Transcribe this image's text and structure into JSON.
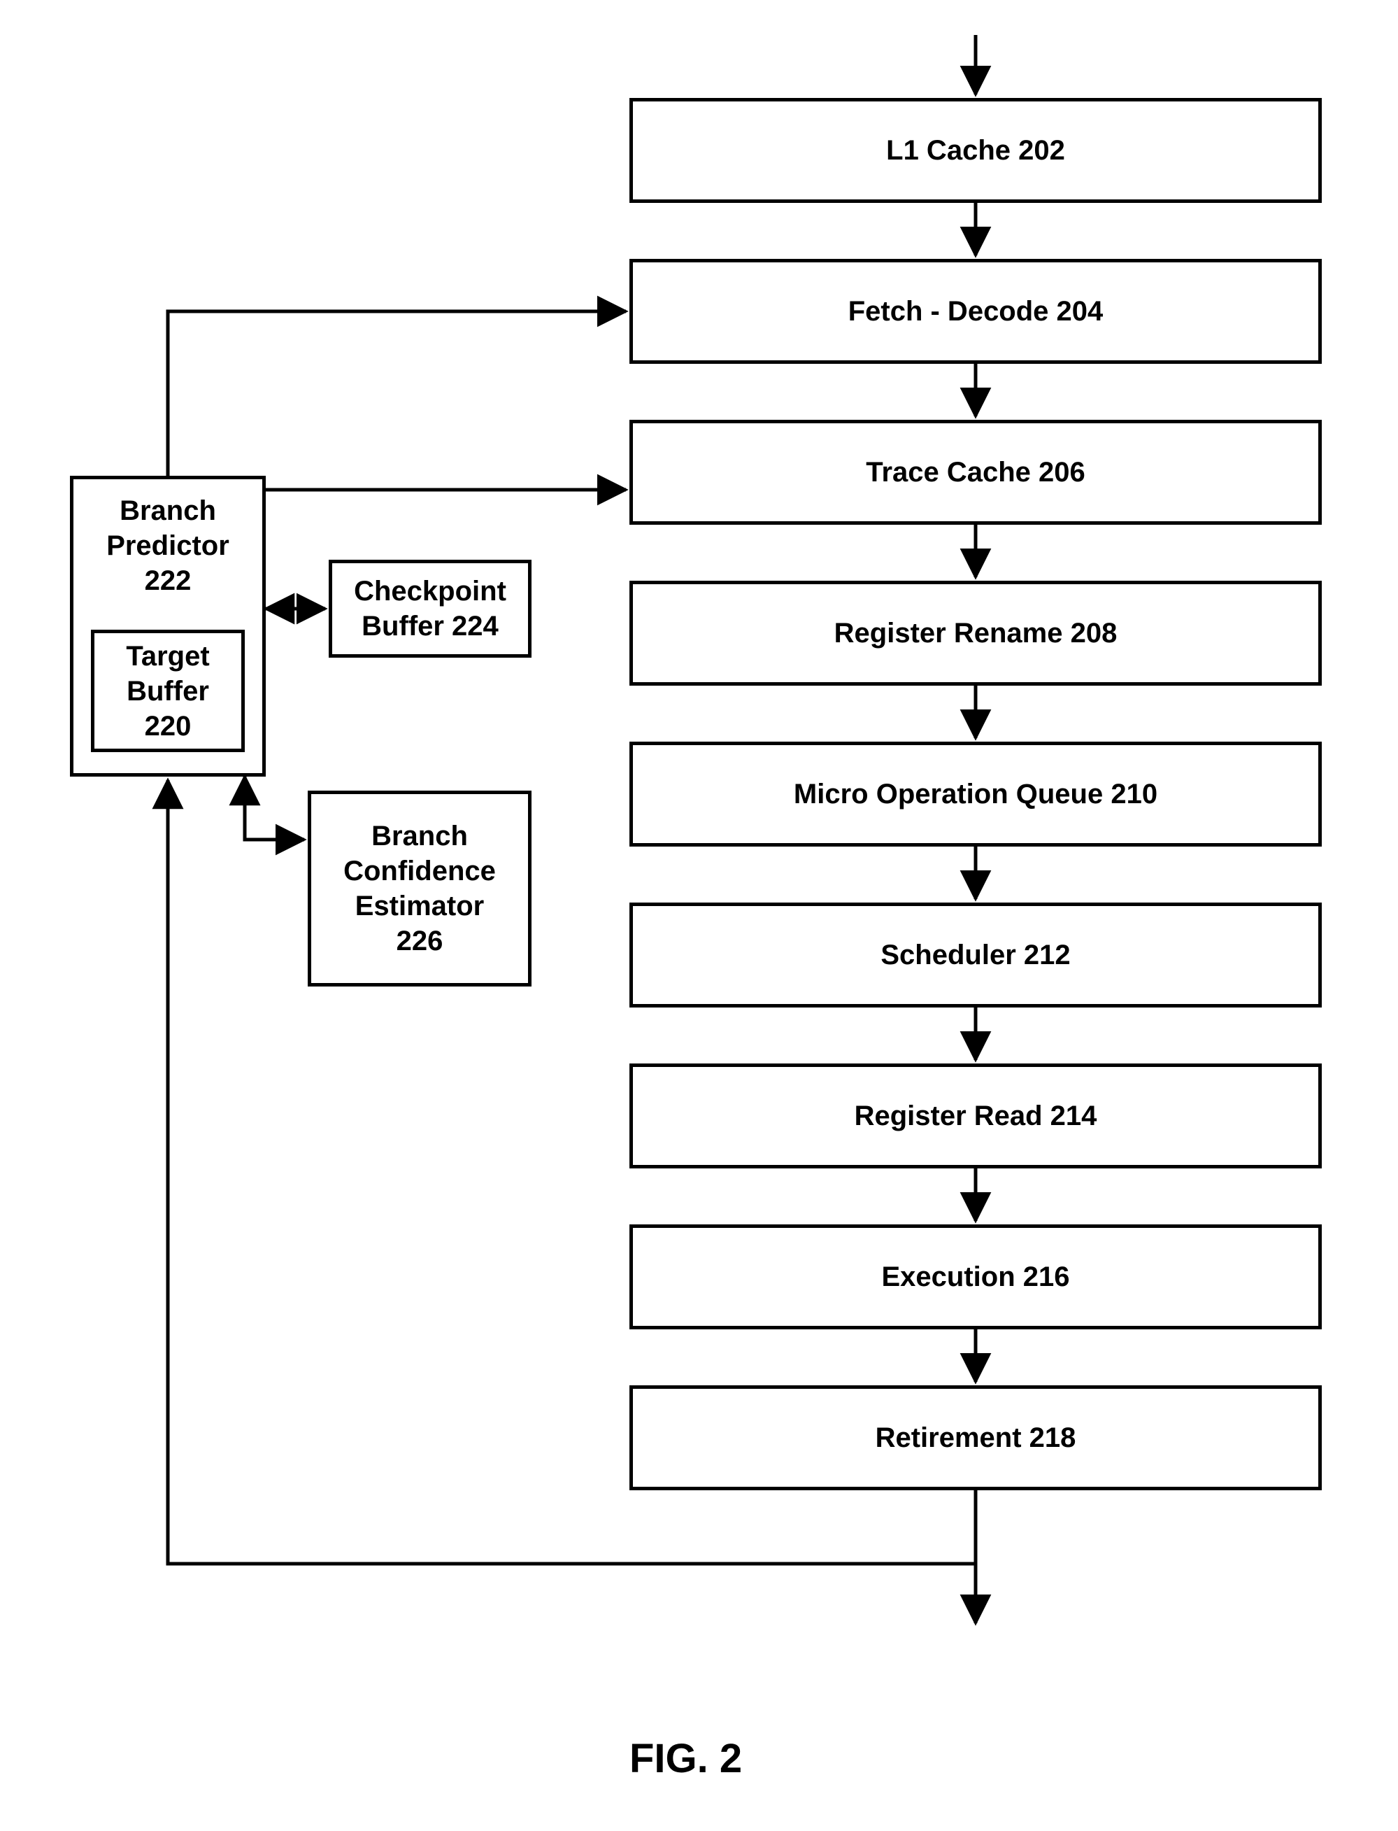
{
  "figure_label": "FIG. 2",
  "pipeline": {
    "l1_cache": "L1 Cache 202",
    "fetch_decode": "Fetch - Decode 204",
    "trace_cache": "Trace Cache 206",
    "register_rename": "Register Rename 208",
    "micro_op_queue": "Micro Operation Queue 210",
    "scheduler": "Scheduler 212",
    "register_read": "Register Read 214",
    "execution": "Execution 216",
    "retirement": "Retirement 218"
  },
  "side": {
    "branch_predictor": "Branch\nPredictor\n222",
    "target_buffer": "Target\nBuffer\n220",
    "checkpoint_buffer": "Checkpoint\nBuffer 224",
    "branch_conf_est": "Branch\nConfidence\nEstimator\n226"
  }
}
